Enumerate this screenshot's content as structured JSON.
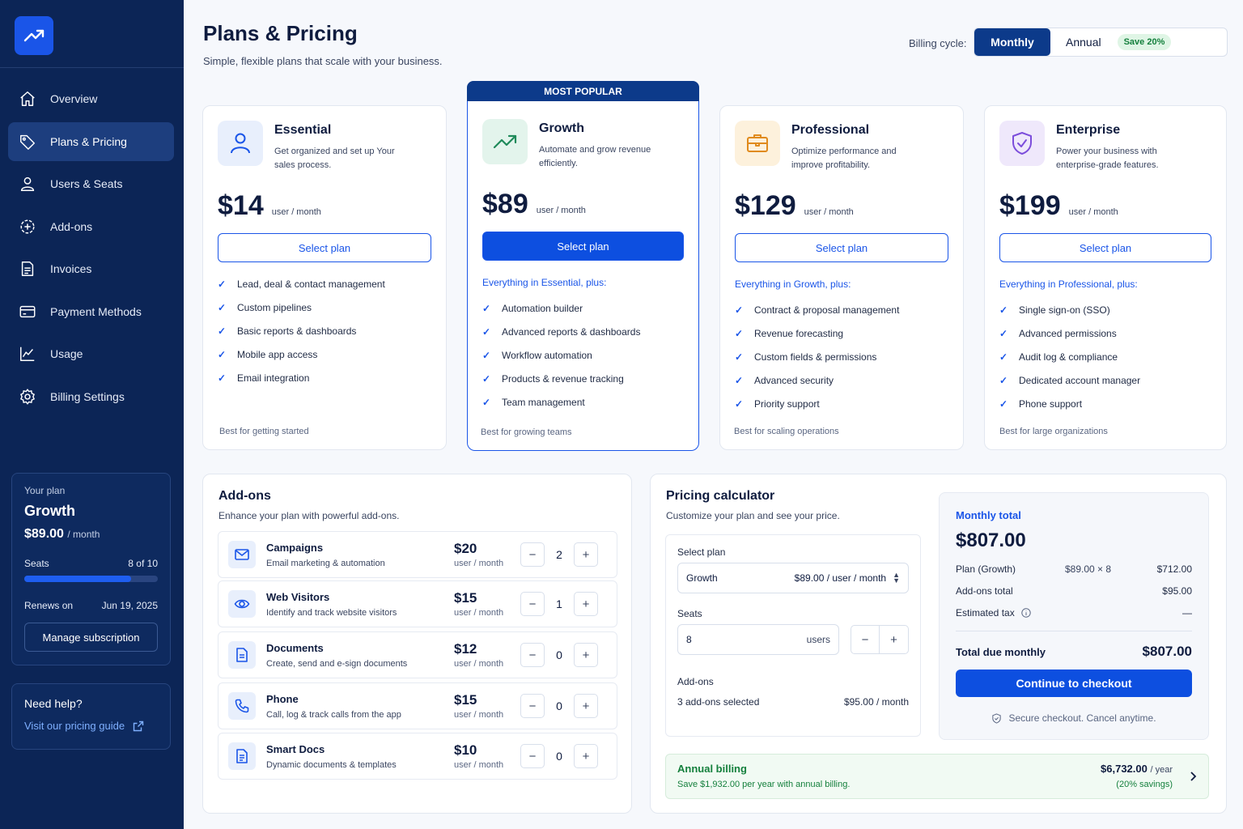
{
  "sidebar": {
    "nav": [
      {
        "label": "Overview",
        "icon": "home-icon"
      },
      {
        "label": "Plans & Pricing",
        "icon": "tag-icon"
      },
      {
        "label": "Users & Seats",
        "icon": "user-icon"
      },
      {
        "label": "Add-ons",
        "icon": "addons-icon"
      },
      {
        "label": "Invoices",
        "icon": "invoice-icon"
      },
      {
        "label": "Payment Methods",
        "icon": "card-icon"
      },
      {
        "label": "Usage",
        "icon": "chart-icon"
      },
      {
        "label": "Billing Settings",
        "icon": "gear-icon"
      }
    ],
    "plan": {
      "caption": "Your plan",
      "name": "Growth",
      "price": "$89.00",
      "per": "/ month",
      "seats_label": "Seats",
      "seats_value": "8 of 10",
      "seats_fraction": 0.8,
      "renews_label": "Renews on",
      "renews_value": "Jun 19, 2025",
      "manage": "Manage subscription"
    },
    "help": {
      "title": "Need help?",
      "link": "Visit our pricing guide"
    }
  },
  "header": {
    "title": "Plans & Pricing",
    "subtitle": "Simple, flexible plans that scale with your business.",
    "cycle_label": "Billing cycle:",
    "monthly": "Monthly",
    "annual": "Annual",
    "save": "Save 20%"
  },
  "most_popular": "MOST POPULAR",
  "plans": [
    {
      "name": "Essential",
      "desc": "Get organized and set up Your sales process.",
      "price": "$14",
      "unit": "user / month",
      "button": "Select plan",
      "heading": "",
      "features": [
        "Lead, deal & contact management",
        "Custom pipelines",
        "Basic reports & dashboards",
        "Mobile app access",
        "Email integration"
      ],
      "best": "Best for getting started"
    },
    {
      "name": "Growth",
      "desc": "Automate and grow revenue efficiently.",
      "price": "$89",
      "unit": "user / month",
      "button": "Select plan",
      "heading": "Everything in Essential, plus:",
      "features": [
        "Automation builder",
        "Advanced reports & dashboards",
        "Workflow automation",
        "Products & revenue tracking",
        "Team management"
      ],
      "best": "Best for growing teams"
    },
    {
      "name": "Professional",
      "desc": "Optimize performance and improve profitability.",
      "price": "$129",
      "unit": "user / month",
      "button": "Select plan",
      "heading": "Everything in Growth, plus:",
      "features": [
        "Contract & proposal management",
        "Revenue forecasting",
        "Custom fields & permissions",
        "Advanced security",
        "Priority support"
      ],
      "best": "Best for scaling operations"
    },
    {
      "name": "Enterprise",
      "desc": "Power your business with enterprise-grade features.",
      "price": "$199",
      "unit": "user / month",
      "button": "Select plan",
      "heading": "Everything in Professional, plus:",
      "features": [
        "Single sign-on (SSO)",
        "Advanced permissions",
        "Audit log & compliance",
        "Dedicated account manager",
        "Phone support"
      ],
      "best": "Best for large organizations"
    }
  ],
  "addons": {
    "title": "Add-ons",
    "subtitle": "Enhance your plan with powerful add-ons.",
    "items": [
      {
        "name": "Campaigns",
        "desc": "Email marketing & automation",
        "price": "$20",
        "unit": "user / month",
        "qty": "2",
        "icon": "mail-icon"
      },
      {
        "name": "Web Visitors",
        "desc": "Identify and track website visitors",
        "price": "$15",
        "unit": "user / month",
        "qty": "1",
        "icon": "eye-icon"
      },
      {
        "name": "Documents",
        "desc": "Create, send and e-sign documents",
        "price": "$12",
        "unit": "user / month",
        "qty": "0",
        "icon": "document-icon"
      },
      {
        "name": "Phone",
        "desc": "Call, log & track calls from the app",
        "price": "$15",
        "unit": "user / month",
        "qty": "0",
        "icon": "phone-icon"
      },
      {
        "name": "Smart Docs",
        "desc": "Dynamic documents & templates",
        "price": "$10",
        "unit": "user / month",
        "qty": "0",
        "icon": "smart-doc-icon"
      }
    ]
  },
  "calculator": {
    "title": "Pricing calculator",
    "subtitle": "Customize your plan and see your price.",
    "select_plan_label": "Select plan",
    "selected_plan": "Growth",
    "selected_price": "$89.00 / user / month",
    "seats_label": "Seats",
    "seats_value": "8",
    "seats_unit": "users",
    "addons_label": "Add-ons",
    "addons_selected": "3 add-ons selected",
    "addons_price": "$95.00 / month",
    "summary": {
      "label": "Monthly total",
      "total": "$807.00",
      "plan_label": "Plan (Growth)",
      "plan_calc": "$89.00 × 8",
      "plan_value": "$712.00",
      "addons_label": "Add-ons total",
      "addons_value": "$95.00",
      "tax_label": "Estimated tax",
      "tax_value": "—",
      "due_label": "Total due monthly",
      "due_value": "$807.00",
      "checkout": "Continue to checkout",
      "secure": "Secure checkout. Cancel anytime."
    },
    "annual": {
      "title": "Annual billing",
      "note": "Save $1,932.00 per year with annual billing.",
      "price": "$6,732.00",
      "per": "/ year",
      "savings": "(20% savings)"
    }
  }
}
